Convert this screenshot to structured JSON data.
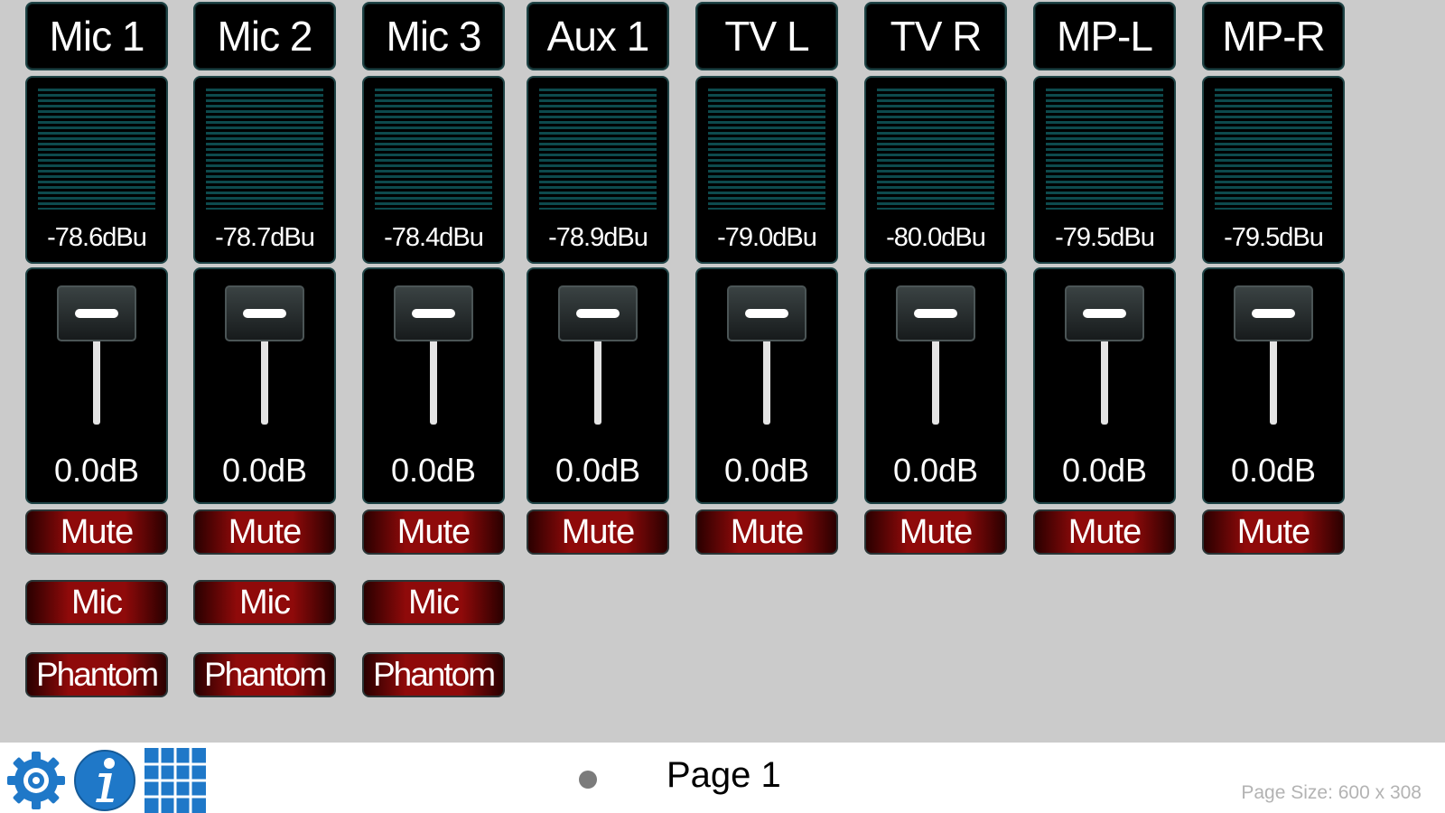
{
  "channels": [
    {
      "name": "Mic 1",
      "meter": "-78.6dBu",
      "gain": "0.0dB",
      "mute": "Mute",
      "mic": "Mic",
      "phantom": "Phantom"
    },
    {
      "name": "Mic 2",
      "meter": "-78.7dBu",
      "gain": "0.0dB",
      "mute": "Mute",
      "mic": "Mic",
      "phantom": "Phantom"
    },
    {
      "name": "Mic 3",
      "meter": "-78.4dBu",
      "gain": "0.0dB",
      "mute": "Mute",
      "mic": "Mic",
      "phantom": "Phantom"
    },
    {
      "name": "Aux 1",
      "meter": "-78.9dBu",
      "gain": "0.0dB",
      "mute": "Mute"
    },
    {
      "name": "TV L",
      "meter": "-79.0dBu",
      "gain": "0.0dB",
      "mute": "Mute"
    },
    {
      "name": "TV R",
      "meter": "-80.0dBu",
      "gain": "0.0dB",
      "mute": "Mute"
    },
    {
      "name": "MP-L",
      "meter": "-79.5dBu",
      "gain": "0.0dB",
      "mute": "Mute"
    },
    {
      "name": "MP-R",
      "meter": "-79.5dBu",
      "gain": "0.0dB",
      "mute": "Mute"
    }
  ],
  "footer": {
    "icons": [
      "gear-icon",
      "info-icon",
      "grid-icon"
    ],
    "page_label": "Page 1",
    "page_size": "Page Size: 600 x 308"
  },
  "colors": {
    "background": "#cbcbcb",
    "panel": "#000000",
    "panel_border": "#1f4446",
    "meter_bars": "#0d4a4d",
    "button_red": "#8f0a0a",
    "icon_blue": "#1f78c8"
  }
}
